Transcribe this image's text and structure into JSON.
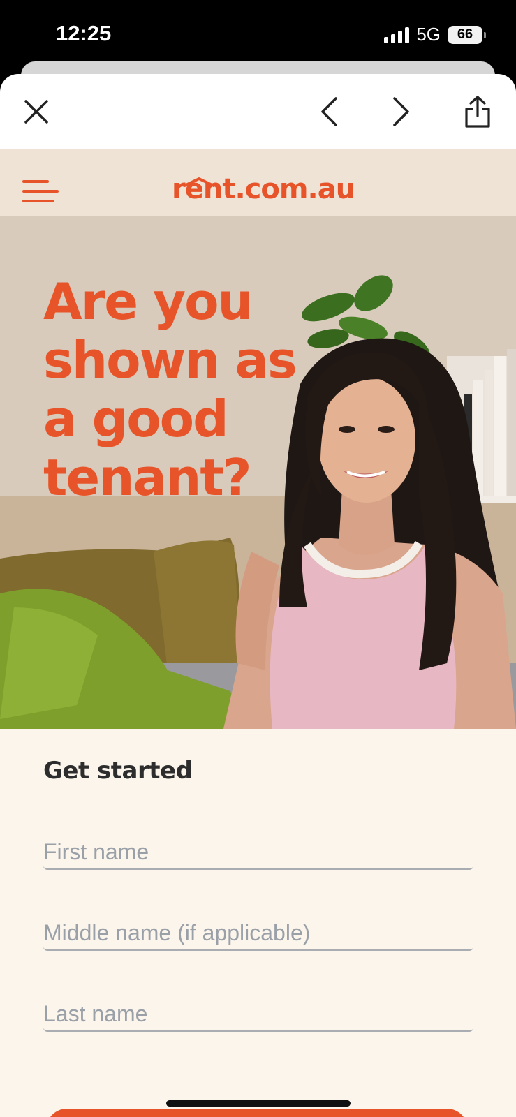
{
  "status_bar": {
    "time": "12:25",
    "network": "5G",
    "battery": "66"
  },
  "browser": {
    "close_label": "Close",
    "back_label": "Back",
    "forward_label": "Forward",
    "share_label": "Share"
  },
  "site": {
    "logo": "rent.com.au",
    "hero_title_lines": [
      "Are you",
      "shown as",
      "a good",
      "tenant?"
    ]
  },
  "form": {
    "heading": "Get started",
    "first_name_placeholder": "First name",
    "middle_name_placeholder": "Middle name (if applicable)",
    "last_name_placeholder": "Last name"
  },
  "colors": {
    "brand": "#e8542a",
    "page_bg": "#fcf5ec",
    "header_bg": "#efe3d6"
  }
}
